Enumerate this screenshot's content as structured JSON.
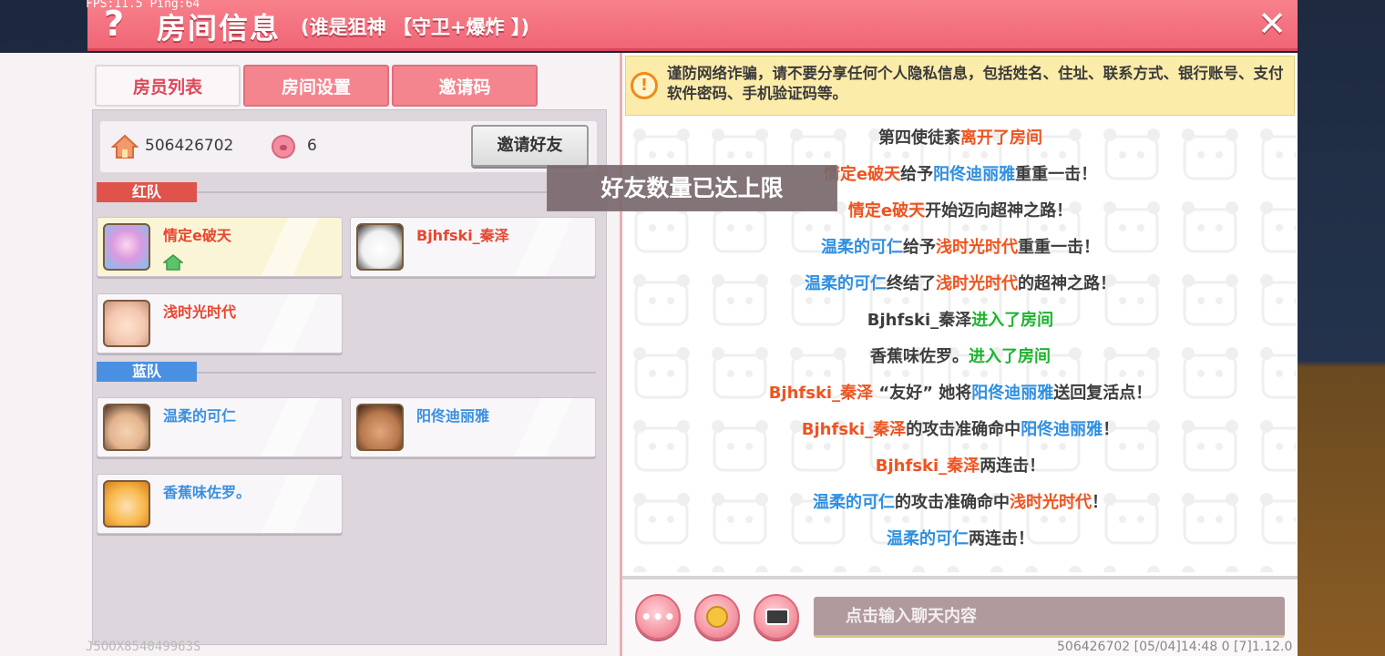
{
  "overlay": {
    "fps": "FPS:11.5  Ping:64",
    "footer_code": "J5OOX854049963S",
    "footer_right": "506426702   [05/04]14:48 0   [7]1.12.0"
  },
  "header": {
    "help_icon": "?",
    "title": "房间信息",
    "subtitle": "(谁是狙神 【守卫+爆炸 】)",
    "close_icon": "✕"
  },
  "tabs": [
    "房员列表",
    "房间设置",
    "邀请码"
  ],
  "room": {
    "room_id": "506426702",
    "player_count": "6",
    "invite_button": "邀请好友"
  },
  "teams": {
    "red": {
      "label": "红队",
      "members": [
        "情定e破天",
        "Bjhfski_秦泽",
        "浅时光时代"
      ]
    },
    "blue": {
      "label": "蓝队",
      "members": [
        "温柔的可仁",
        "阳佟迪丽雅",
        "香蕉味佐罗。"
      ]
    }
  },
  "warning": {
    "icon": "!",
    "text": "谨防网络诈骗，请不要分享任何个人隐私信息，包括姓名、住址、联系方式、银行账号、支付软件密码、手机验证码等。"
  },
  "chat": [
    [
      {
        "t": "第四使徒紊",
        "c": "dark"
      },
      {
        "t": "离开了房间",
        "c": "red"
      }
    ],
    [
      {
        "t": "情定e破天",
        "c": "red"
      },
      {
        "t": "给予",
        "c": "dark"
      },
      {
        "t": "阳佟迪丽雅",
        "c": "blue"
      },
      {
        "t": "重重一击！",
        "c": "dark"
      }
    ],
    [
      {
        "t": "情定e破天",
        "c": "red"
      },
      {
        "t": "开始迈向超神之路！",
        "c": "dark"
      }
    ],
    [
      {
        "t": "温柔的可仁",
        "c": "blue"
      },
      {
        "t": "给予",
        "c": "dark"
      },
      {
        "t": "浅时光时代",
        "c": "red"
      },
      {
        "t": "重重一击！",
        "c": "dark"
      }
    ],
    [
      {
        "t": "温柔的可仁",
        "c": "blue"
      },
      {
        "t": "终结了",
        "c": "dark"
      },
      {
        "t": "浅时光时代",
        "c": "red"
      },
      {
        "t": "的超神之路！",
        "c": "dark"
      }
    ],
    [
      {
        "t": "Bjhfski_秦泽",
        "c": "dark"
      },
      {
        "t": "进入了房间",
        "c": "green"
      }
    ],
    [
      {
        "t": "香蕉味佐罗。",
        "c": "dark"
      },
      {
        "t": "进入了房间",
        "c": "green"
      }
    ],
    [
      {
        "t": "Bjhfski_秦泽",
        "c": "red"
      },
      {
        "t": " “友好” 她将",
        "c": "dark"
      },
      {
        "t": "阳佟迪丽雅",
        "c": "blue"
      },
      {
        "t": "送回复活点！",
        "c": "dark"
      }
    ],
    [
      {
        "t": "Bjhfski_秦泽",
        "c": "red"
      },
      {
        "t": "的攻击准确命中",
        "c": "dark"
      },
      {
        "t": "阳佟迪丽雅",
        "c": "blue"
      },
      {
        "t": "！",
        "c": "dark"
      }
    ],
    [
      {
        "t": "Bjhfski_秦泽",
        "c": "red"
      },
      {
        "t": "两连击！",
        "c": "dark"
      }
    ],
    [
      {
        "t": "温柔的可仁",
        "c": "blue"
      },
      {
        "t": "的攻击准确命中",
        "c": "dark"
      },
      {
        "t": "浅时光时代",
        "c": "red"
      },
      {
        "t": "！",
        "c": "dark"
      }
    ],
    [
      {
        "t": "温柔的可仁",
        "c": "blue"
      },
      {
        "t": "两连击！",
        "c": "dark"
      }
    ]
  ],
  "chat_input": {
    "placeholder": "点击输入聊天内容"
  },
  "bottom_buttons": {
    "more": "•••"
  },
  "toast": "好友数量已达上限",
  "colors": {
    "title_bar": "#f06676",
    "red_team": "#e0534b",
    "blue_team": "#4a90e2",
    "name_red": "#e8462f",
    "name_blue": "#3a90e0",
    "chat_green": "#1db42e"
  },
  "icons": {
    "house": "house-icon",
    "pig": "pig-icon",
    "host": "host-house-icon",
    "emoji": "emoji-icon",
    "keyboard": "keyboard-icon",
    "more": "more-dots-icon"
  }
}
